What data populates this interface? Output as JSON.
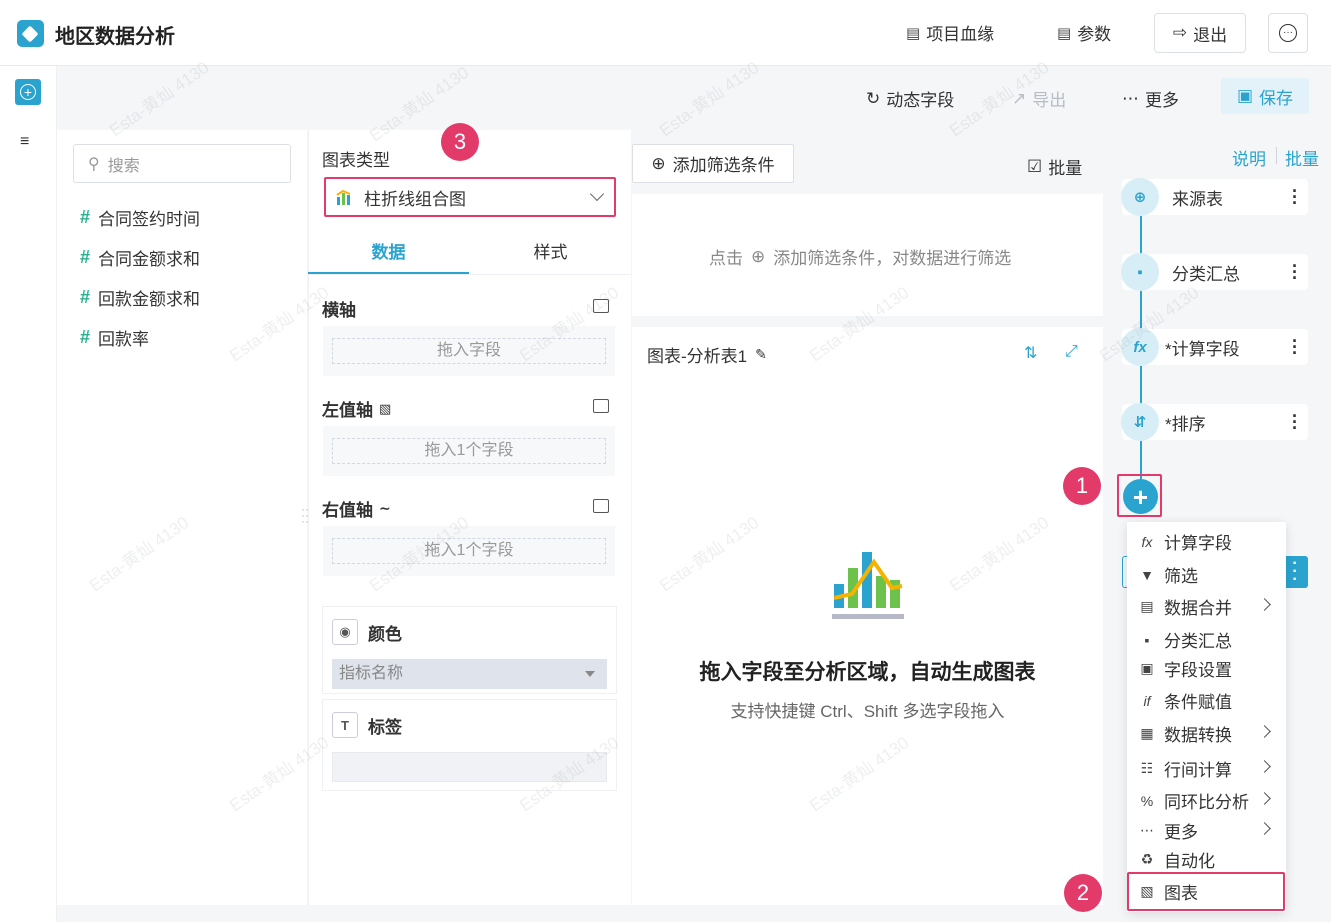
{
  "app": {
    "title": "地区数据分析"
  },
  "topbar": {
    "lineage": "项目血缘",
    "params": "参数",
    "exit": "退出"
  },
  "toolbar": {
    "dynamic_field": "动态字段",
    "export": "导出",
    "more": "更多",
    "save": "保存"
  },
  "fields": {
    "search_placeholder": "搜索",
    "items": [
      "合同签约时间",
      "合同金额求和",
      "回款金额求和",
      "回款率"
    ]
  },
  "config": {
    "chart_type_label": "图表类型",
    "chart_type_value": "柱折线组合图",
    "tabs": [
      "数据",
      "样式"
    ],
    "x_axis": "横轴",
    "x_drop": "拖入字段",
    "left_axis": "左值轴",
    "left_drop": "拖入1个字段",
    "right_axis": "右值轴",
    "right_drop": "拖入1个字段",
    "color_label": "颜色",
    "color_value": "指标名称",
    "tag_label": "标签"
  },
  "filter": {
    "add_button": "添加筛选条件",
    "batch": "批量",
    "hint_prefix": "点击",
    "hint_suffix": "添加筛选条件，对数据进行筛选"
  },
  "canvas": {
    "title": "图表-分析表1",
    "empty_title": "拖入字段至分析区域，自动生成图表",
    "empty_sub": "支持快捷键 Ctrl、Shift 多选字段拖入"
  },
  "flow": {
    "explain": "说明",
    "batch": "批量",
    "nodes": [
      "来源表",
      "分类汇总",
      "*计算字段",
      "*排序"
    ]
  },
  "menu": {
    "items": [
      "计算字段",
      "筛选",
      "数据合并",
      "分类汇总",
      "字段设置",
      "条件赋值",
      "数据转换",
      "行间计算",
      "同环比分析",
      "更多",
      "自动化",
      "图表"
    ]
  },
  "badges": [
    "1",
    "2",
    "3"
  ],
  "watermark": "Esta-黄灿 4130",
  "colors": {
    "accent": "#2aa3cf",
    "highlight": "#e23b6a",
    "field_hash": "#2ab08f"
  }
}
